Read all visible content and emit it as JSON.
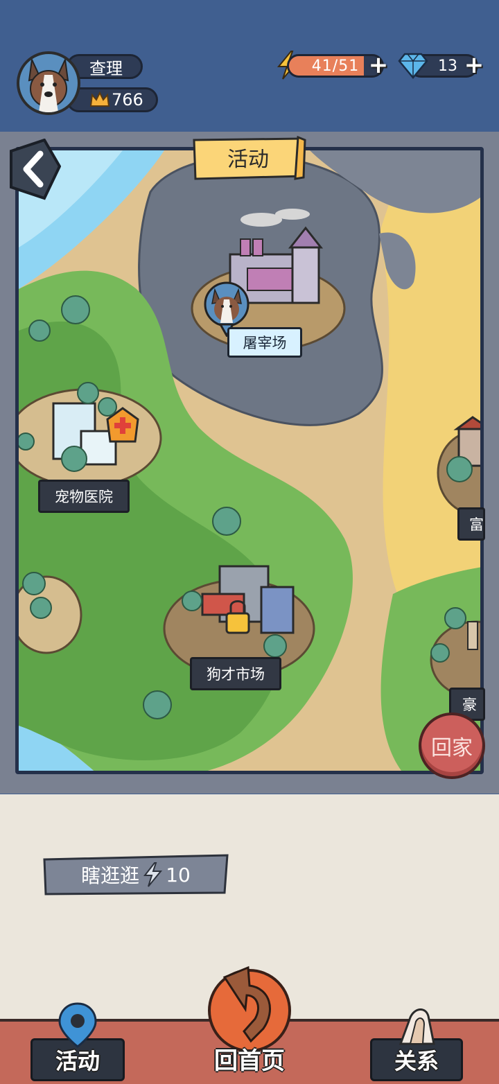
{
  "player": {
    "name": "查理",
    "score": "766",
    "avatar_icon": "dog-avatar-icon"
  },
  "energy": {
    "text": "41/51",
    "current": 41,
    "max": 51,
    "color": "#e8805a"
  },
  "gems": {
    "count": "13"
  },
  "map": {
    "title": "活动",
    "locations": [
      {
        "label": "屠宰场"
      },
      {
        "label": "宠物医院"
      },
      {
        "label": "狗才市场",
        "locked": true
      },
      {
        "label": "富"
      },
      {
        "label": "豪"
      }
    ]
  },
  "buttons": {
    "home": "回家",
    "wander": "瞎逛逛",
    "wander_cost": "10"
  },
  "nav": {
    "activity": "活动",
    "home_page": "回首页",
    "relations": "关系"
  },
  "colors": {
    "hud_bg": "#405f90",
    "panel_bg": "#ebe6dc",
    "nav_bg": "#c4695a",
    "accent_orange": "#e8805a"
  }
}
